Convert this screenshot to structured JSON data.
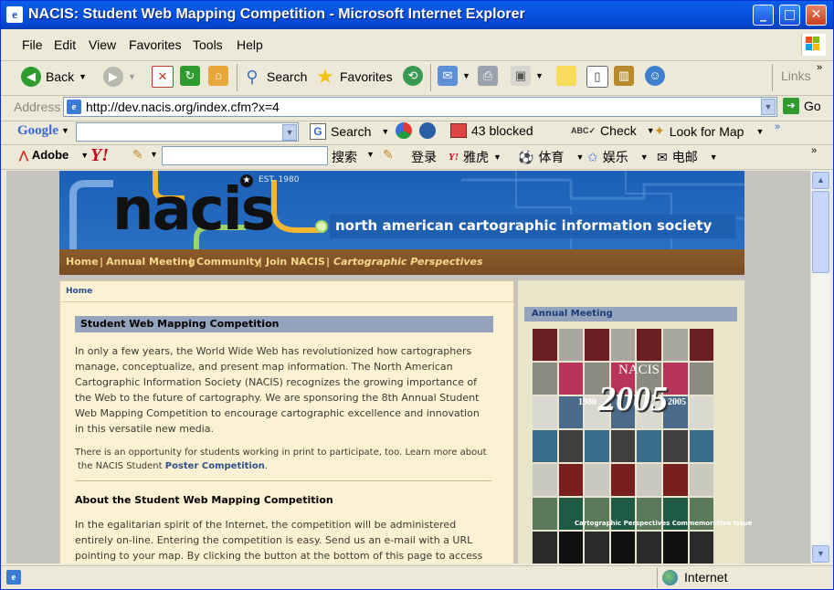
{
  "window": {
    "title": "NACIS: Student Web Mapping Competition - Microsoft Internet Explorer"
  },
  "menu": [
    "File",
    "Edit",
    "View",
    "Favorites",
    "Tools",
    "Help"
  ],
  "toolbar": {
    "back": "Back",
    "search": "Search",
    "favorites": "Favorites",
    "links": "Links"
  },
  "address": {
    "label": "Address",
    "url": "http://dev.nacis.org/index.cfm?x=4",
    "go": "Go"
  },
  "google_bar": {
    "logo": "Google",
    "search": "Search",
    "blocked": "43 blocked",
    "check": "Check",
    "look_for_map": "Look for Map"
  },
  "yahoo_bar": {
    "adobe": "Adobe",
    "yahoo": "Y!",
    "search_btn": "搜索",
    "login": "登录",
    "yahoo_cn": "雅虎",
    "sports": "体育",
    "entertainment": "娱乐",
    "email": "电邮"
  },
  "status": {
    "zone": "Internet"
  },
  "page": {
    "banner": {
      "logo": "nacis",
      "est": "EST. 1980",
      "society": "north american cartographic information society"
    },
    "nav": [
      {
        "label": "Home"
      },
      {
        "label": "Annual Meeting"
      },
      {
        "label": "Community"
      },
      {
        "label": "Join NACIS"
      },
      {
        "label": "Cartographic Perspectives"
      }
    ],
    "breadcrumb": "Home",
    "heading": "Student Web Mapping Competition",
    "intro": "In only a few years, the World Wide Web has revolutionized how cartographers manage, conceptualize, and present map information. The North American Cartographic Information Society (NACIS) recognizes the growing importance of the Web to the future of cartography. We are sponsoring the 8th Annual Student Web Mapping Competition to encourage cartographic excellence and innovation in this versatile new media.",
    "print_note": "There is an opportunity for students working in print to participate, too. Learn more about",
    "print_note2": "the NACIS Student",
    "print_link": "Poster Competition",
    "about_heading": "About the Student Web Mapping Competition",
    "about_text": "In the egalitarian spirit of the Internet, the competition will be administered entirely on-line. Entering the competition is easy. Send us an e-mail with a URL pointing to your map. By clicking the button at the bottom of this page to access",
    "sidebar_heading": "Annual Meeting",
    "cover": {
      "title": "NACIS",
      "year_start": "1980",
      "year_big": "2005",
      "year_end": "2005",
      "caption": "Cartographic Perspectives Commemorative Issue"
    }
  }
}
